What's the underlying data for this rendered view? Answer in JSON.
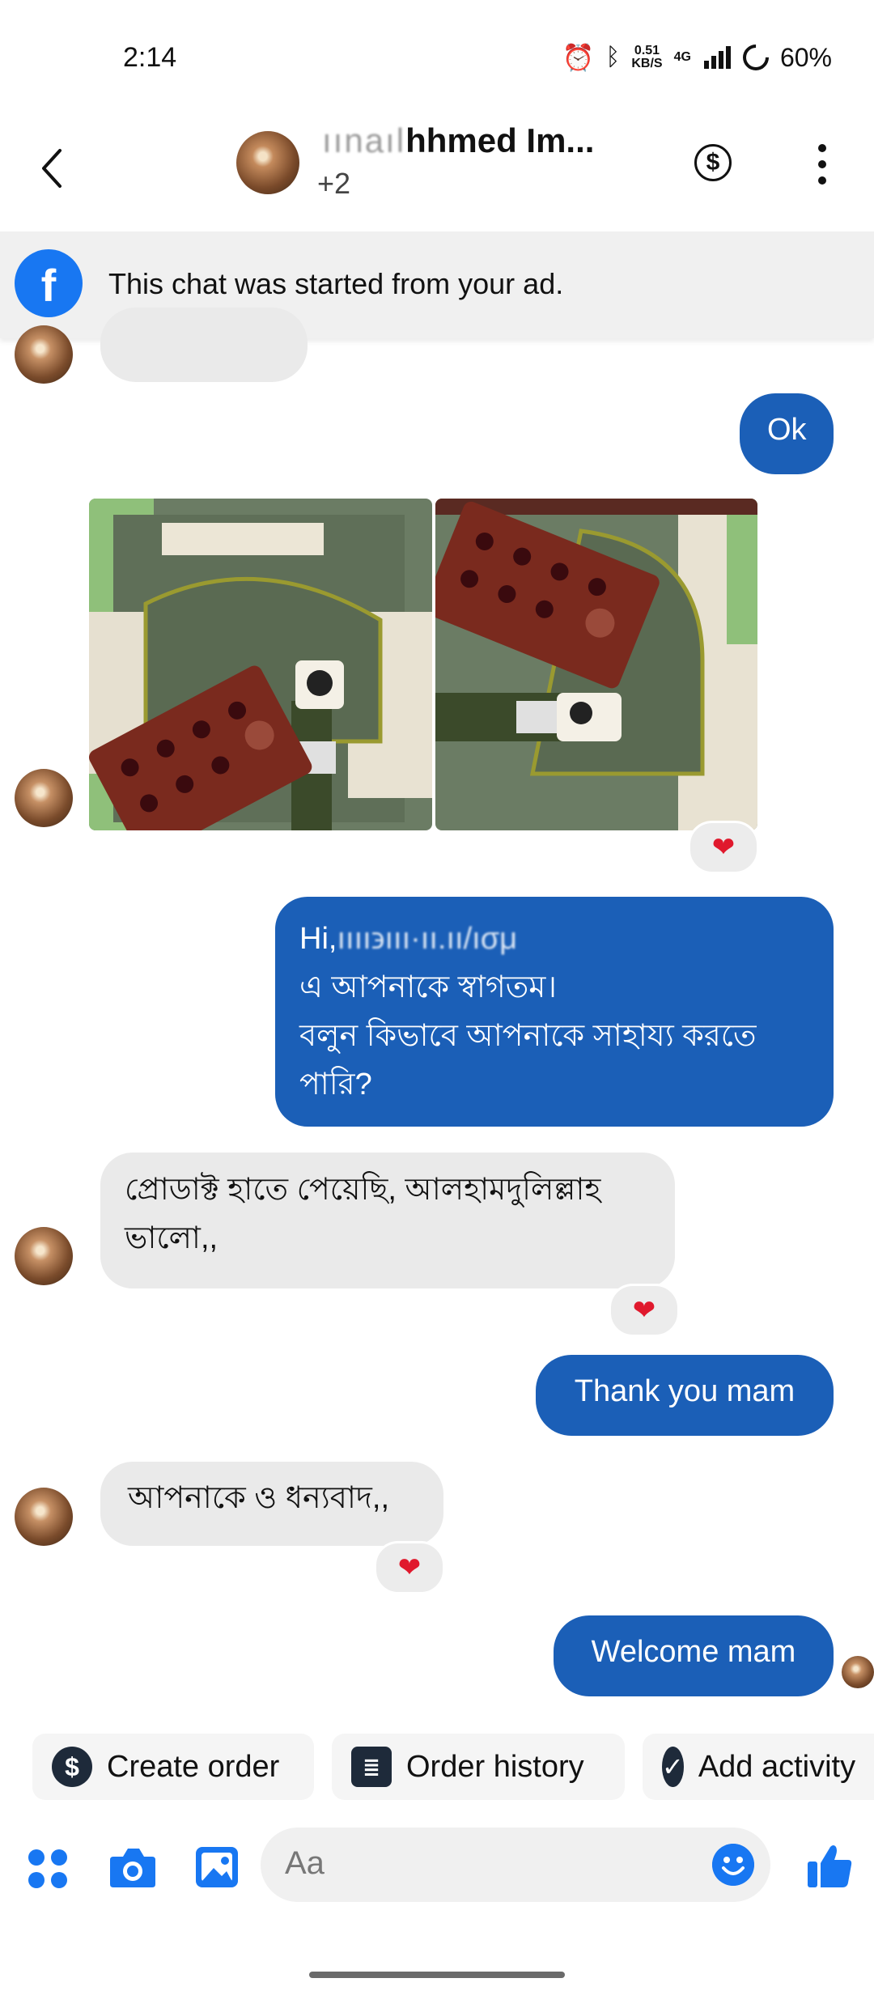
{
  "status_bar": {
    "time": "2:14",
    "speed_value": "0.51",
    "speed_unit": "KB/S",
    "network": "4G",
    "battery": "60%"
  },
  "header": {
    "title_hidden": "ıınaıl",
    "title_visible": "hhmed Im...",
    "subtitle": "+2"
  },
  "banner": {
    "text": "This chat was started from your ad."
  },
  "messages": {
    "ok": "Ok",
    "greeting_line1_prefix": "Hi,",
    "greeting_line1_hidden": "ıııı϶ııı·ıı.ıı/ıσμ",
    "greeting_line2": "এ আপনাকে স্বাগতম।",
    "greeting_line3": "বলুন কিভাবে আপনাকে সাহায্য করতে",
    "greeting_line4": "পারি?",
    "received_product_1": "প্রোডাক্ট হাতে পেয়েছি, আলহামদুলিল্লাহ",
    "received_product_2": "ভালো,,",
    "thank_you": "Thank you mam",
    "thanks_back": "আপনাকে ও ধন্যবাদ,,",
    "welcome": "Welcome mam"
  },
  "reactions": {
    "heart": "❤"
  },
  "quick_actions": [
    {
      "label": "Create order",
      "icon": "dollar-icon"
    },
    {
      "label": "Order history",
      "icon": "list-icon"
    },
    {
      "label": "Add activity",
      "icon": "check-icon"
    }
  ],
  "composer": {
    "placeholder": "Aa"
  },
  "colors": {
    "outgoing_bubble": "#1b5fb7",
    "incoming_bubble": "#eaeaea",
    "accent": "#1877f2"
  }
}
